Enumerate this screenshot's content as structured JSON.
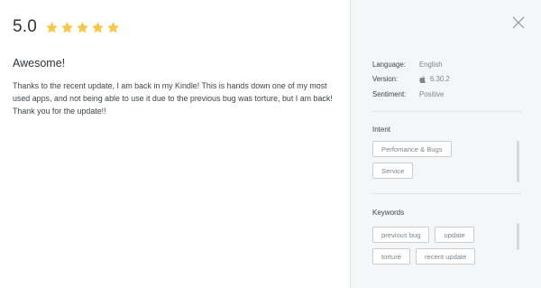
{
  "review": {
    "rating": "5.0",
    "stars": 5,
    "star_color": "#f5c84c",
    "title": "Awesome!",
    "body": "Thanks to the recent update, I am back in my Kindle! This is hands down one of my most used apps, and not being able to use it due to the previous bug was torture, but I am back! Thank you for the update!!"
  },
  "details": {
    "close_icon": "close-icon",
    "meta": [
      {
        "key": "Language:",
        "value": "English",
        "icon": ""
      },
      {
        "key": "Version:",
        "value": "6.30.2",
        "icon": "apple-icon"
      },
      {
        "key": "Sentiment:",
        "value": "Positive",
        "icon": ""
      }
    ],
    "intent": {
      "title": "Intent",
      "tags": [
        "Perfomance & Bugs",
        "Service"
      ]
    },
    "keywords": {
      "title": "Keywords",
      "tags": [
        "previous bug",
        "update",
        "torture",
        "recent update"
      ]
    }
  }
}
